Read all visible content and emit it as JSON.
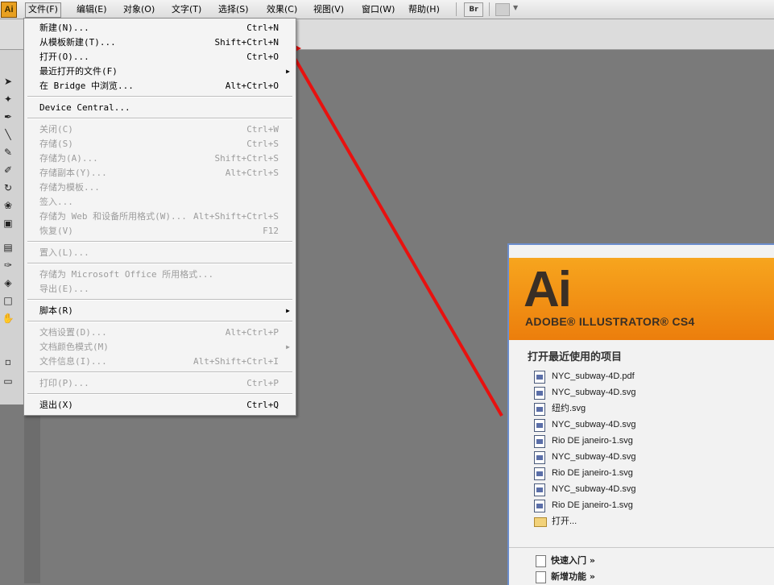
{
  "app": {
    "logo_text": "Ai"
  },
  "menubar": {
    "items": [
      "文件(F)",
      "编辑(E)",
      "对象(O)",
      "文字(T)",
      "选择(S)",
      "效果(C)",
      "视图(V)",
      "窗口(W)",
      "帮助(H)"
    ],
    "bridge_label": "Br"
  },
  "file_menu": {
    "items": [
      {
        "label": "新建(N)...",
        "shortcut": "Ctrl+N",
        "enabled": true
      },
      {
        "label": "从模板新建(T)...",
        "shortcut": "Shift+Ctrl+N",
        "enabled": true
      },
      {
        "label": "打开(O)...",
        "shortcut": "Ctrl+O",
        "enabled": true
      },
      {
        "label": "最近打开的文件(F)",
        "shortcut": "",
        "enabled": true,
        "submenu": true
      },
      {
        "label": "在 Bridge 中浏览...",
        "shortcut": "Alt+Ctrl+O",
        "enabled": true
      },
      {
        "label": "Device Central...",
        "shortcut": "",
        "enabled": true
      },
      {
        "label": "关闭(C)",
        "shortcut": "Ctrl+W",
        "enabled": false
      },
      {
        "label": "存储(S)",
        "shortcut": "Ctrl+S",
        "enabled": false
      },
      {
        "label": "存储为(A)...",
        "shortcut": "Shift+Ctrl+S",
        "enabled": false
      },
      {
        "label": "存储副本(Y)...",
        "shortcut": "Alt+Ctrl+S",
        "enabled": false
      },
      {
        "label": "存储为模板...",
        "shortcut": "",
        "enabled": false
      },
      {
        "label": "签入...",
        "shortcut": "",
        "enabled": false
      },
      {
        "label": "存储为 Web 和设备所用格式(W)...",
        "shortcut": "Alt+Shift+Ctrl+S",
        "enabled": false
      },
      {
        "label": "恢复(V)",
        "shortcut": "F12",
        "enabled": false
      },
      {
        "label": "置入(L)...",
        "shortcut": "",
        "enabled": false
      },
      {
        "label": "存储为 Microsoft Office 所用格式...",
        "shortcut": "",
        "enabled": false
      },
      {
        "label": "导出(E)...",
        "shortcut": "",
        "enabled": false
      },
      {
        "label": "脚本(R)",
        "shortcut": "",
        "enabled": true,
        "submenu": true
      },
      {
        "label": "文档设置(D)...",
        "shortcut": "Alt+Ctrl+P",
        "enabled": false
      },
      {
        "label": "文档颜色模式(M)",
        "shortcut": "",
        "enabled": false,
        "submenu": true
      },
      {
        "label": "文件信息(I)...",
        "shortcut": "Alt+Shift+Ctrl+I",
        "enabled": false
      },
      {
        "label": "打印(P)...",
        "shortcut": "Ctrl+P",
        "enabled": false
      },
      {
        "label": "退出(X)",
        "shortcut": "Ctrl+Q",
        "enabled": true
      }
    ]
  },
  "welcome": {
    "logo": "Ai",
    "product": "ADOBE® ILLUSTRATOR® CS4",
    "recent_title": "打开最近使用的项目",
    "recent_files": [
      "NYC_subway-4D.pdf",
      "NYC_subway-4D.svg",
      "纽约.svg",
      "NYC_subway-4D.svg",
      "Rio DE janeiro-1.svg",
      "NYC_subway-4D.svg",
      "Rio DE janeiro-1.svg",
      "NYC_subway-4D.svg",
      "Rio DE janeiro-1.svg"
    ],
    "open_label": "打开...",
    "bottom_links": [
      "快速入门 »",
      "新增功能 »"
    ]
  },
  "annotation": {
    "arrow_color": "#e8110f"
  }
}
